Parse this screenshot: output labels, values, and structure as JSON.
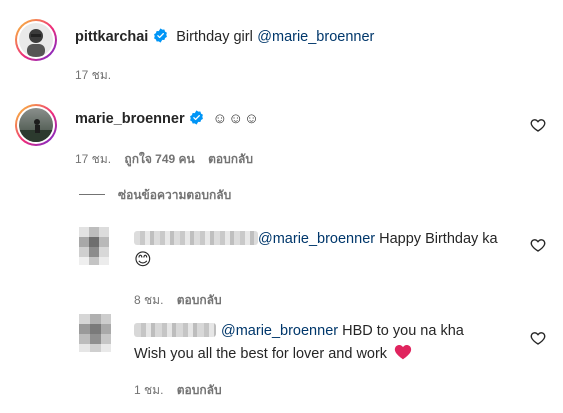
{
  "post_caption": {
    "username": "pittkarchai",
    "verified": true,
    "text": "Birthday girl",
    "mention": "@marie_broenner",
    "time": "17 ชม."
  },
  "comment": {
    "username": "marie_broenner",
    "verified": true,
    "text": "☺☺☺",
    "time": "17 ชม.",
    "likes": "ถูกใจ 749 คน",
    "reply_label": "ตอบกลับ"
  },
  "hide_replies_label": "ซ่อนข้อความตอบกลับ",
  "replies": [
    {
      "mention": "@marie_broenner",
      "text": "Happy Birthday ka",
      "emoji": "😊",
      "time": "8 ชม.",
      "reply_label": "ตอบกลับ"
    },
    {
      "mention": "@marie_broenner",
      "text_line1": "HBD to you na kha",
      "text_line2": "Wish you all the best for lover and work",
      "emoji": "❤️",
      "time": "1 ชม.",
      "reply_label": "ตอบกลับ"
    }
  ],
  "colors": {
    "mention": "#00376b",
    "verified": "#0095f6",
    "meta": "#737373"
  },
  "icons": [
    "verified-badge-icon",
    "heart-outline-icon",
    "heart-emoji-icon",
    "smile-emoji-icon"
  ]
}
